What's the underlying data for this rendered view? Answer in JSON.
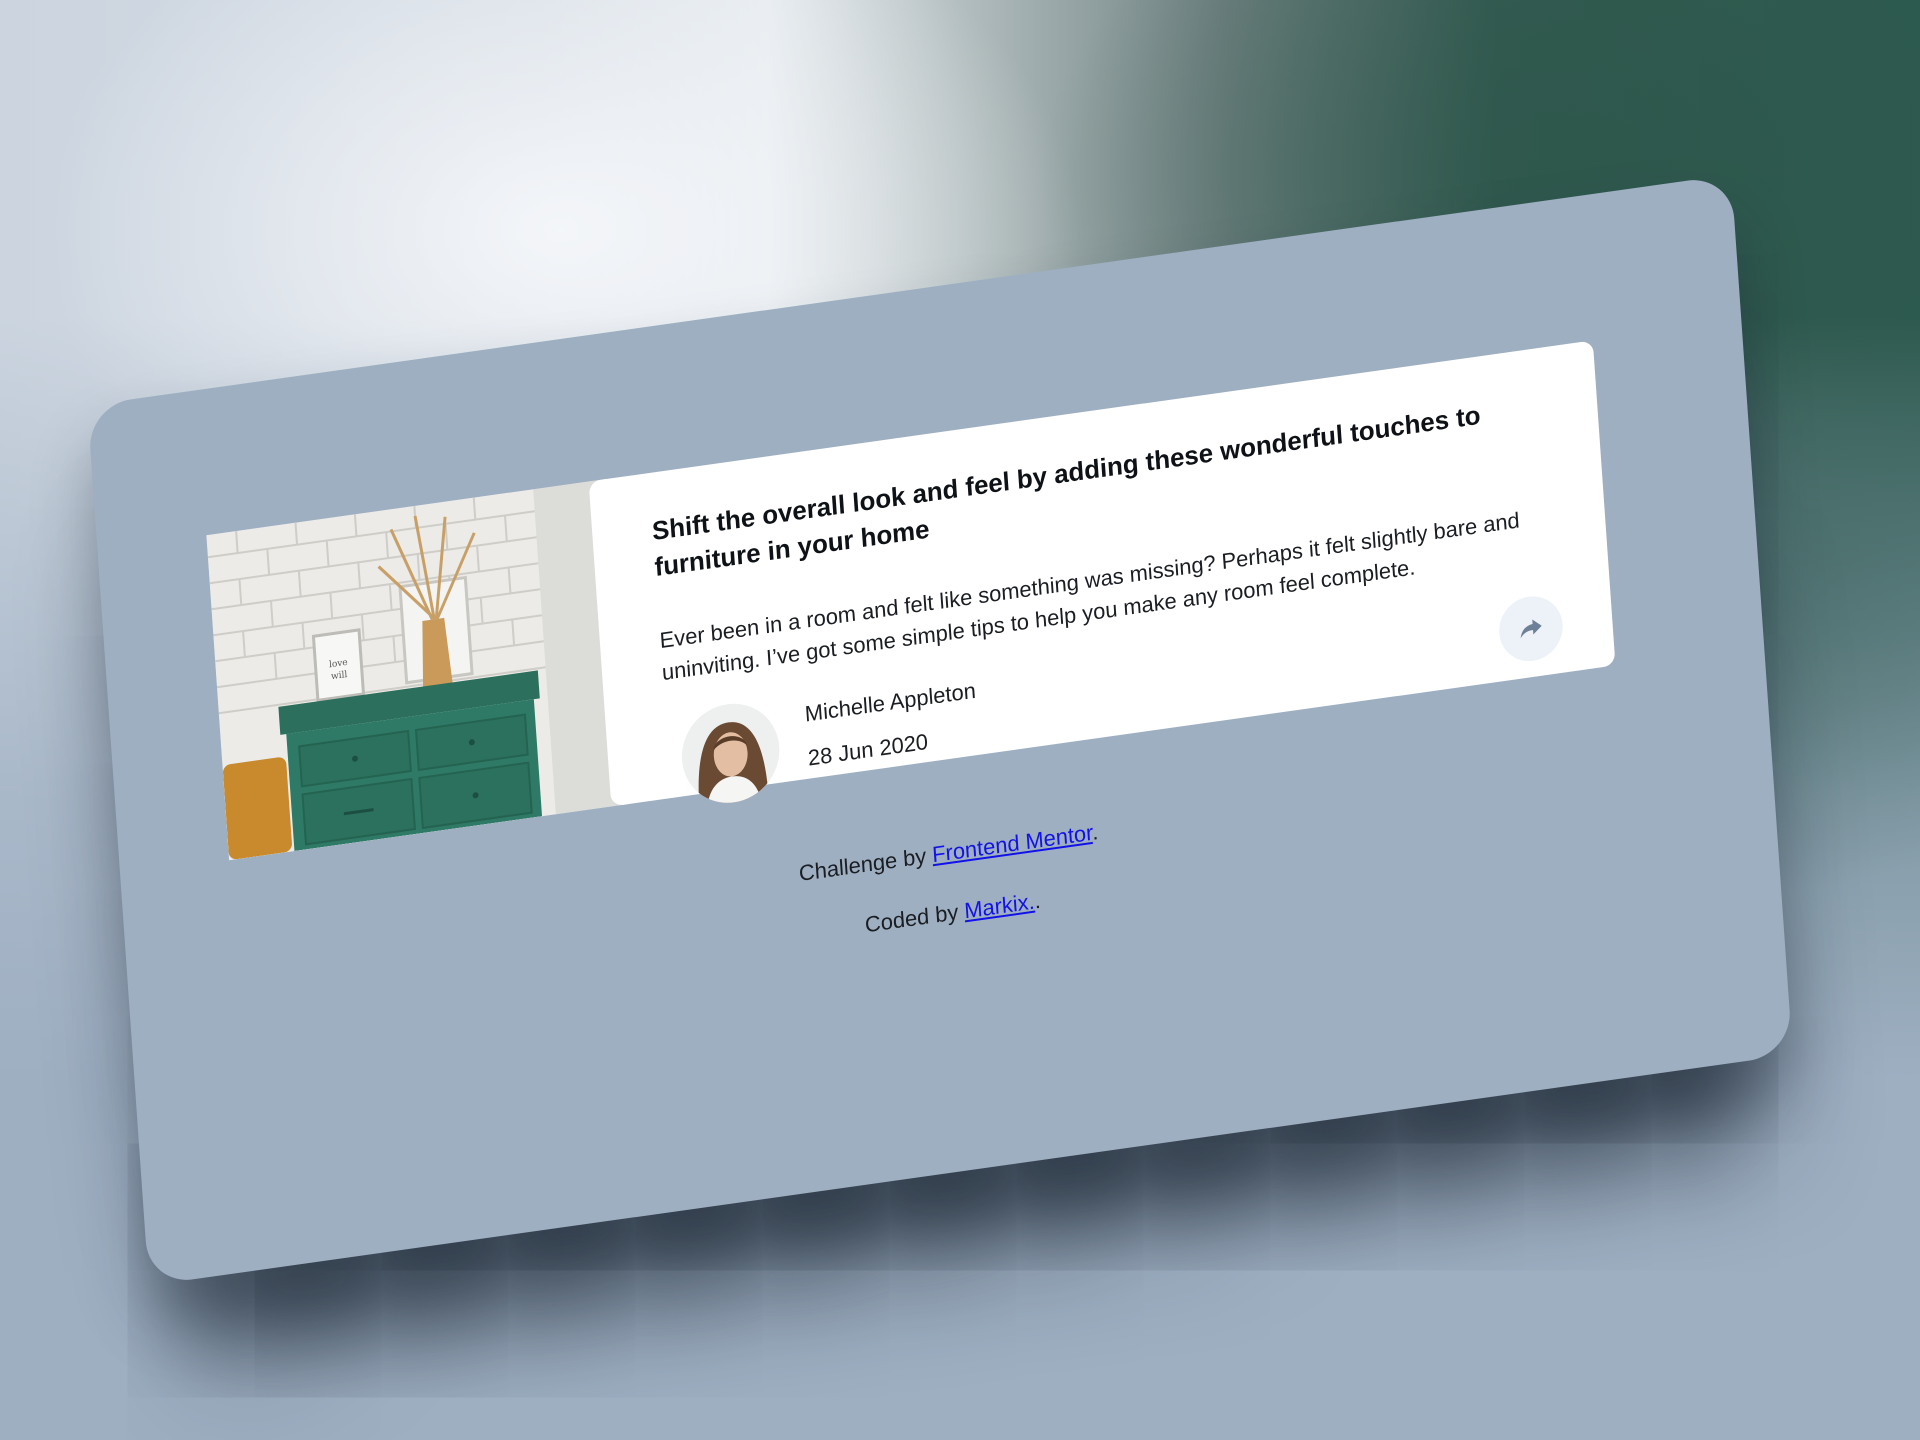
{
  "article": {
    "title": "Shift the overall look and feel by adding these wonderful touches to furniture in your home",
    "description": "Ever been in a room and felt like something was missing? Perhaps it felt slightly bare and uninviting. I’ve got some simple tips to help you make any room feel complete.",
    "image_icon": "drawers-photo",
    "author": {
      "name": "Michelle Appleton",
      "date": "28 Jun 2020",
      "avatar_icon": "avatar-photo"
    },
    "share_icon": "share-icon"
  },
  "attribution": {
    "challenge_prefix": "Challenge by",
    "challenge_link": "Frontend Mentor",
    "challenge_suffix": ".",
    "coded_prefix": "Coded by",
    "coded_link": "Markix.",
    "coded_suffix": "."
  },
  "colors": {
    "screen_bg": "#9eafc2",
    "card_bg": "#ffffff",
    "share_bg": "#ecf2f8",
    "share_icon": "#6e8098",
    "link": "#1212e8",
    "drawer_green": "#2f7a66",
    "vase": "#c99a5a"
  }
}
